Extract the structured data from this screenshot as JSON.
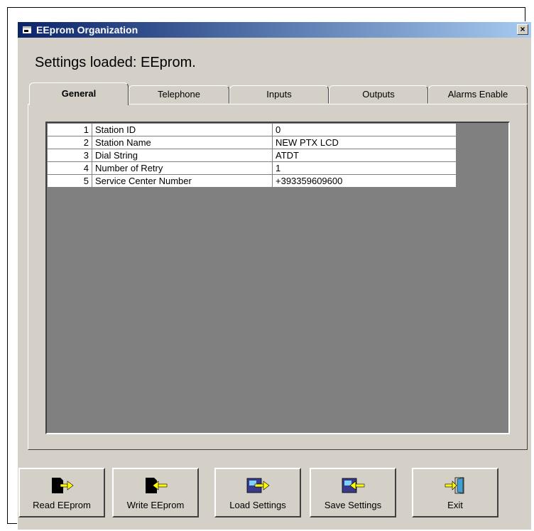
{
  "window": {
    "title": "EEprom Organization",
    "close_label": "×"
  },
  "status": "Settings loaded:  EEprom.",
  "tabs": [
    {
      "label": "General"
    },
    {
      "label": "Telephone"
    },
    {
      "label": "Inputs"
    },
    {
      "label": "Outputs"
    },
    {
      "label": "Alarms Enable"
    }
  ],
  "grid": {
    "rows": [
      {
        "num": "1",
        "name": "Station ID",
        "value": "0"
      },
      {
        "num": "2",
        "name": "Station Name",
        "value": "NEW PTX LCD"
      },
      {
        "num": "3",
        "name": "Dial String",
        "value": "ATDT"
      },
      {
        "num": "4",
        "name": "Number of Retry",
        "value": "1"
      },
      {
        "num": "5",
        "name": "Service Center Number",
        "value": "+393359609600"
      }
    ]
  },
  "buttons": {
    "read": "Read EEprom",
    "write": "Write EEprom",
    "load": "Load Settings",
    "save": "Save Settings",
    "exit": "Exit"
  },
  "icons": {
    "read": "chip-arrow-right-icon",
    "write": "chip-arrow-left-icon",
    "load": "computer-arrow-right-icon",
    "save": "computer-arrow-left-icon",
    "exit": "door-exit-icon"
  },
  "colors": {
    "title_gradient_start": "#0a246a",
    "title_gradient_end": "#a6caf0",
    "grid_background": "#808080",
    "arrow_yellow": "#ffff00"
  }
}
